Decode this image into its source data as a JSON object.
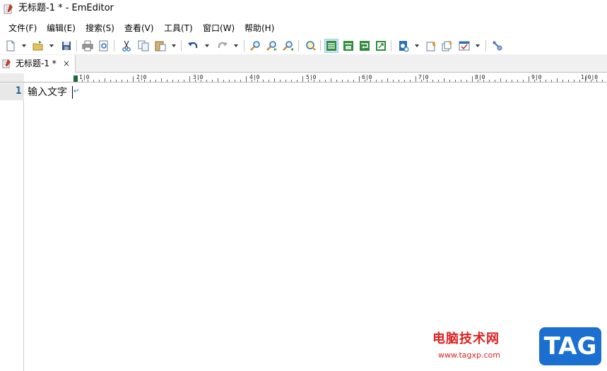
{
  "window": {
    "title": "无标题-1 * - EmEditor",
    "icon": "notepad-icon"
  },
  "menu": {
    "items": [
      {
        "label": "文件(F)"
      },
      {
        "label": "编辑(E)"
      },
      {
        "label": "搜索(S)"
      },
      {
        "label": "查看(V)"
      },
      {
        "label": "工具(T)"
      },
      {
        "label": "窗口(W)"
      },
      {
        "label": "帮助(H)"
      }
    ]
  },
  "toolbar": {
    "buttons": [
      "new-file-icon",
      "open-folder-icon",
      "save-icon",
      "print-icon",
      "print-preview-icon",
      "cut-icon",
      "copy-icon",
      "paste-icon",
      "undo-icon",
      "redo-icon",
      "find-icon",
      "find-next-icon",
      "find-previous-icon",
      "highlight-icon",
      "markers-icon",
      "wrap-off-icon",
      "wrap-by-chars-icon",
      "wrap-by-window-icon",
      "encoding-icon",
      "configuration-icon",
      "all-configurations-icon",
      "customize-icon",
      "plugins-icon"
    ]
  },
  "tabs": [
    {
      "label": "无标题-1 *",
      "close": "×",
      "icon": "notepad-icon"
    }
  ],
  "ruler": {
    "labels": [
      "1|0",
      "2|0",
      "3|0",
      "4|0",
      "5|0",
      "6|0",
      "7|0",
      "8|0",
      "9|0",
      "1|0|0"
    ]
  },
  "editor": {
    "line_numbers": [
      "1"
    ],
    "lines": [
      "输入文字"
    ],
    "eol_mark": "↵"
  },
  "watermark": {
    "title": "电脑技术网",
    "url": "www.tagxp.com",
    "badge": "TAG"
  },
  "colors": {
    "accent": "#1a6fd1",
    "line_number": "#1a5a8a",
    "watermark_red": "#e02020"
  }
}
